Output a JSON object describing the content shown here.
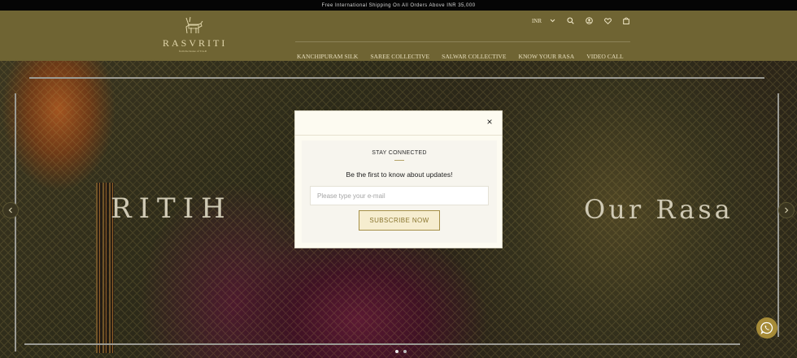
{
  "announcement": "Free International Shipping On All Orders Above INR 35,000",
  "brand": {
    "name": "RASVRITI",
    "tagline": "from the house of V.A.R"
  },
  "utilities": {
    "currency": "INR",
    "icons": [
      "chevron-down-icon",
      "search-icon",
      "account-icon",
      "wishlist-heart-icon",
      "cart-bag-icon"
    ]
  },
  "nav": {
    "items": [
      {
        "label": "KANCHIPURAM SILK"
      },
      {
        "label": "SAREE COLLECTIVE"
      },
      {
        "label": "SALWAR COLLECTIVE"
      },
      {
        "label": "KNOW YOUR RASA"
      },
      {
        "label": "VIDEO CALL"
      }
    ]
  },
  "hero": {
    "left_text": "RITIH",
    "right_text": "Our Rasa",
    "slides": 2,
    "active_slide": 1
  },
  "newsletter_modal": {
    "title": "STAY CONNECTED",
    "subtitle": "Be the first to know about updates!",
    "email": {
      "value": "",
      "placeholder": "Please type your e-mail"
    },
    "subscribe_label": "SUBSCRIBE NOW",
    "close_label": "×"
  },
  "colors": {
    "header_bg": "#6f6433",
    "announcement_bg": "#050505",
    "accent_gold": "#a58f47",
    "whatsapp_bg": "#a68b38"
  }
}
